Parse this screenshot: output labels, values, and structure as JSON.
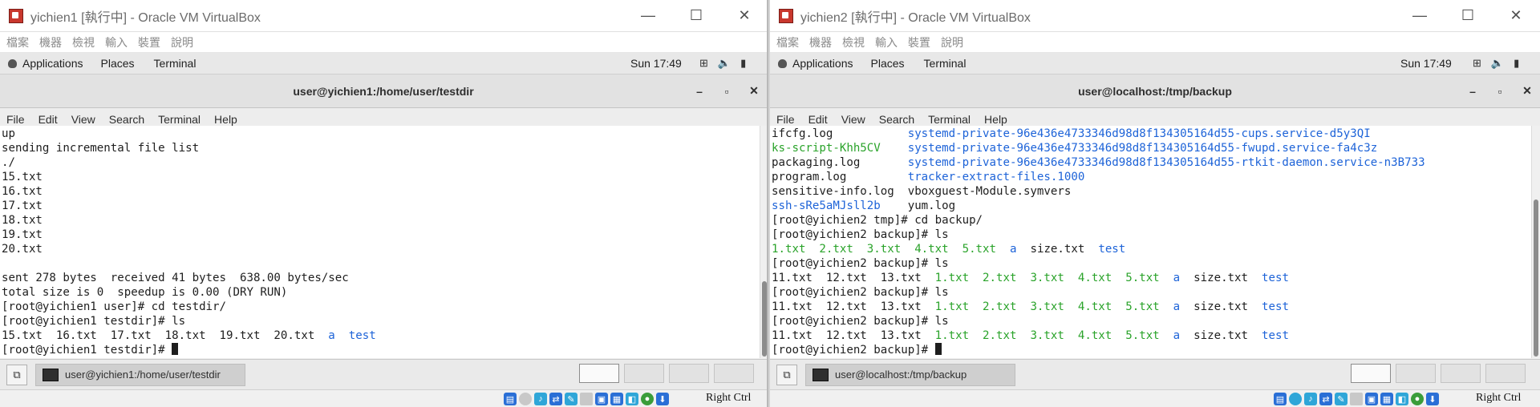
{
  "vbox_menu": [
    "檔案",
    "機器",
    "檢視",
    "輸入",
    "裝置",
    "說明"
  ],
  "window_controls": {
    "minimize": "—",
    "maximize": "☐",
    "close": "✕"
  },
  "gnome": {
    "applications": "Applications",
    "places": "Places",
    "terminal": "Terminal",
    "clock": "Sun 17:49"
  },
  "terminal_menu": [
    "File",
    "Edit",
    "View",
    "Search",
    "Terminal",
    "Help"
  ],
  "terminal_controls": {
    "minimize": "–",
    "maximize": "▫",
    "close": "✕"
  },
  "host_key": "Right Ctrl",
  "vms": [
    {
      "vbox_title": "yichien1 [執行中] - Oracle VM VirtualBox",
      "terminal_title": "user@yichien1:/home/user/testdir",
      "taskbar_label": "user@yichien1:/home/user/testdir",
      "lines": [
        [
          {
            "t": "up"
          }
        ],
        [
          {
            "t": "sending incremental file list"
          }
        ],
        [
          {
            "t": "./"
          }
        ],
        [
          {
            "t": "15.txt"
          }
        ],
        [
          {
            "t": "16.txt"
          }
        ],
        [
          {
            "t": "17.txt"
          }
        ],
        [
          {
            "t": "18.txt"
          }
        ],
        [
          {
            "t": "19.txt"
          }
        ],
        [
          {
            "t": "20.txt"
          }
        ],
        [
          {
            "t": ""
          }
        ],
        [
          {
            "t": "sent 278 bytes  received 41 bytes  638.00 bytes/sec"
          }
        ],
        [
          {
            "t": "total size is 0  speedup is 0.00 (DRY RUN)"
          }
        ],
        [
          {
            "t": "[root@yichien1 user]# cd testdir/"
          }
        ],
        [
          {
            "t": "[root@yichien1 testdir]# ls"
          }
        ],
        [
          {
            "t": "15.txt  16.txt  17.txt  18.txt  19.txt  20.txt  "
          },
          {
            "t": "a",
            "c": "b"
          },
          {
            "t": "  "
          },
          {
            "t": "test",
            "c": "b"
          }
        ],
        [
          {
            "t": "[root@yichien1 testdir]# "
          },
          {
            "cursor": true
          }
        ]
      ]
    },
    {
      "vbox_title": "yichien2 [執行中] - Oracle VM VirtualBox",
      "terminal_title": "user@localhost:/tmp/backup",
      "taskbar_label": "user@localhost:/tmp/backup",
      "lines": [
        [
          {
            "t": "ifcfg.log           "
          },
          {
            "t": "systemd-private-96e436e4733346d98d8f134305164d55-cups.service-d5y3QI",
            "c": "b"
          }
        ],
        [
          {
            "t": "ks-script-Khh5CV",
            "c": "g"
          },
          {
            "t": "    "
          },
          {
            "t": "systemd-private-96e436e4733346d98d8f134305164d55-fwupd.service-fa4c3z",
            "c": "b"
          }
        ],
        [
          {
            "t": "packaging.log       "
          },
          {
            "t": "systemd-private-96e436e4733346d98d8f134305164d55-rtkit-daemon.service-n3B733",
            "c": "b"
          }
        ],
        [
          {
            "t": "program.log         "
          },
          {
            "t": "tracker-extract-files.1000",
            "c": "b"
          }
        ],
        [
          {
            "t": "sensitive-info.log  vboxguest-Module.symvers"
          }
        ],
        [
          {
            "t": "ssh-sRe5aMJsll2b",
            "c": "b"
          },
          {
            "t": "    yum.log"
          }
        ],
        [
          {
            "t": "[root@yichien2 tmp]# cd backup/"
          }
        ],
        [
          {
            "t": "[root@yichien2 backup]# ls"
          }
        ],
        [
          {
            "t": "1.txt  2.txt  3.txt  4.txt  5.txt",
            "c": "g"
          },
          {
            "t": "  "
          },
          {
            "t": "a",
            "c": "b"
          },
          {
            "t": "  size.txt  "
          },
          {
            "t": "test",
            "c": "b"
          }
        ],
        [
          {
            "t": "[root@yichien2 backup]# ls"
          }
        ],
        [
          {
            "t": "11.txt  12.txt  13.txt  "
          },
          {
            "t": "1.txt  2.txt  3.txt  4.txt  5.txt",
            "c": "g"
          },
          {
            "t": "  "
          },
          {
            "t": "a",
            "c": "b"
          },
          {
            "t": "  size.txt  "
          },
          {
            "t": "test",
            "c": "b"
          }
        ],
        [
          {
            "t": "[root@yichien2 backup]# ls"
          }
        ],
        [
          {
            "t": "11.txt  12.txt  13.txt  "
          },
          {
            "t": "1.txt  2.txt  3.txt  4.txt  5.txt",
            "c": "g"
          },
          {
            "t": "  "
          },
          {
            "t": "a",
            "c": "b"
          },
          {
            "t": "  size.txt  "
          },
          {
            "t": "test",
            "c": "b"
          }
        ],
        [
          {
            "t": "[root@yichien2 backup]# ls"
          }
        ],
        [
          {
            "t": "11.txt  12.txt  13.txt  "
          },
          {
            "t": "1.txt  2.txt  3.txt  4.txt  5.txt",
            "c": "g"
          },
          {
            "t": "  "
          },
          {
            "t": "a",
            "c": "b"
          },
          {
            "t": "  size.txt  "
          },
          {
            "t": "test",
            "c": "b"
          }
        ],
        [
          {
            "t": "[root@yichien2 backup]# "
          },
          {
            "cursor": true
          }
        ]
      ]
    }
  ],
  "colors": {
    "green": "#2aa32a",
    "blue": "#1d63d8",
    "terminal_bg": "#ffffff"
  }
}
